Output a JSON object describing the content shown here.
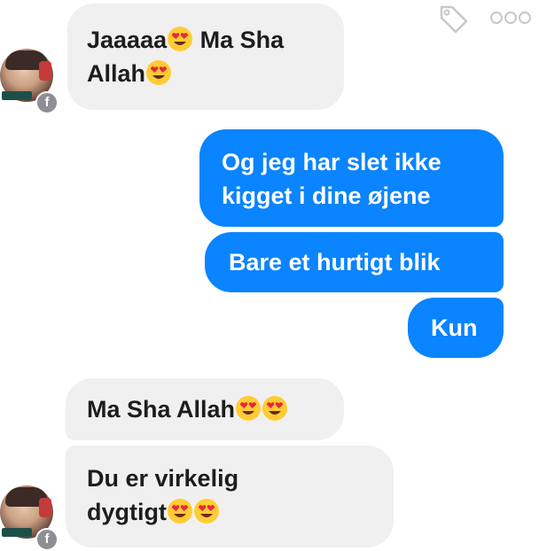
{
  "messages": [
    {
      "id": "m1",
      "side": "in",
      "text": "Jaaaaa",
      "emoji_after_first": true,
      "text2": " Ma Sha",
      "line2": "Allah",
      "emoji_after_line2": 1
    },
    {
      "id": "m2",
      "side": "out",
      "line1": "Og jeg har slet ikke",
      "line2": "kigget i dine øjene"
    },
    {
      "id": "m3",
      "side": "out",
      "text": "Bare et hurtigt blik"
    },
    {
      "id": "m4",
      "side": "out",
      "text": "Kun"
    },
    {
      "id": "m5",
      "side": "in",
      "text": "Ma Sha Allah",
      "emoji_count": 2
    },
    {
      "id": "m6",
      "side": "in",
      "line1": "Du er virkelig",
      "line2": "dygtigt",
      "emoji_count": 2
    }
  ],
  "badge": {
    "label": "f"
  },
  "icons": {
    "tag": "tag-icon",
    "more": "more-dots-icon",
    "emoji": "heart-eyes-emoji-icon",
    "avatar": "profile-avatar"
  },
  "colors": {
    "incoming_bg": "#f1f0f0",
    "outgoing_bg": "#0a84ff",
    "incoming_text": "#1d1d1d",
    "outgoing_text": "#ffffff"
  }
}
